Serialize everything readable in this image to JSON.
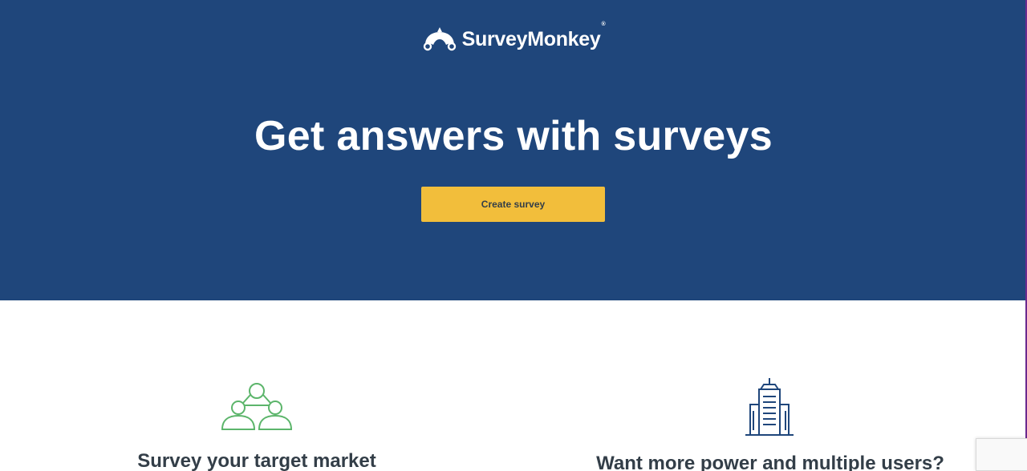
{
  "brand": {
    "name": "SurveyMonkey",
    "registered_mark": "®"
  },
  "hero": {
    "headline": "Get answers with surveys",
    "cta_label": "Create survey"
  },
  "features": [
    {
      "icon": "people-network-icon",
      "title": "Survey your target market"
    },
    {
      "icon": "building-icon",
      "title": "Want more power and multiple users?"
    }
  ],
  "colors": {
    "hero_bg": "#1f467b",
    "cta_bg": "#f2be3b",
    "text_dark": "#333e48",
    "green_icon": "#5cb56b",
    "navy_icon": "#1f467b"
  }
}
